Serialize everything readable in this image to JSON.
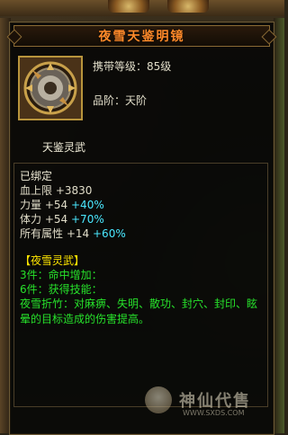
{
  "item": {
    "title": "夜雪天鉴明镜",
    "level_text": "携带等级：85级",
    "grade_text": "品阶：天阶",
    "type_name": "天鉴灵武",
    "icon": "mirror-artifact-icon"
  },
  "stats": {
    "bound": "已绑定",
    "hp": {
      "label": "血上限",
      "base": "+3830"
    },
    "power": {
      "label": "力量",
      "base": "+54",
      "bonus": "+40%"
    },
    "stamina": {
      "label": "体力",
      "base": "+54",
      "bonus": "+70%"
    },
    "all_attr": {
      "label": "所有属性",
      "base": "+14",
      "bonus": "+60%"
    }
  },
  "set": {
    "title": "【夜雪灵武】",
    "line1": "3件：命中增加：",
    "line2": "6件：获得技能：",
    "skill": "夜雪折竹：对麻痹、失明、散功、封穴、封印、眩晕的目标造成的伤害提高。"
  },
  "watermark": {
    "text": "神仙代售",
    "url": "WWW.SXDS.COM"
  },
  "colors": {
    "title": "#ff8a2a",
    "bonus": "#4ae8ff",
    "set_title": "#ffe600",
    "set_line": "#27e22b"
  }
}
